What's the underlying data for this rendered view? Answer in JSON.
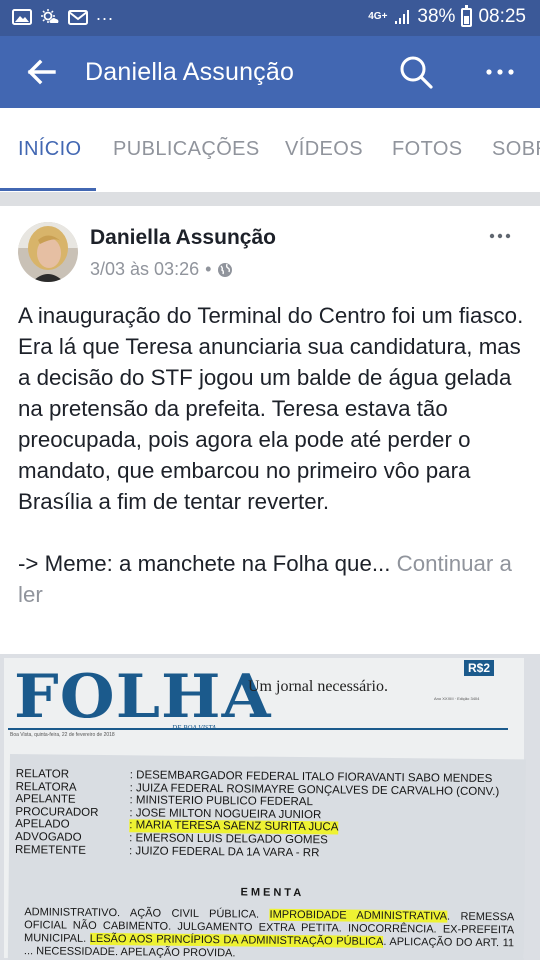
{
  "status_bar": {
    "overflow_dots": "...",
    "network": "4G+",
    "battery": "38%",
    "time": "08:25"
  },
  "app_bar": {
    "title": "Daniella Assunção"
  },
  "tabs": [
    {
      "label": "INÍCIO",
      "active": true
    },
    {
      "label": "PUBLICAÇÕES",
      "active": false
    },
    {
      "label": "VÍDEOS",
      "active": false
    },
    {
      "label": "FOTOS",
      "active": false
    },
    {
      "label": "SOBR",
      "active": false
    }
  ],
  "post": {
    "author": "Daniella Assunção",
    "timestamp": "3/03 às 03:26",
    "separator": "•",
    "privacy_icon": "globe-icon",
    "paragraph1": "A inauguração do Terminal do Centro foi um fiasco. Era lá que Teresa anunciaria sua candidatura, mas a decisão do STF jogou um balde de água gelada na pretensão da prefeita. Teresa estava tão preocupada, pois agora ela pode até perder o mandato, que embarcou no primeiro vôo para Brasília a fim de tentar reverter.",
    "paragraph2": "-> Meme: a manchete na Folha que...",
    "continue_label": "Continuar a ler"
  },
  "photo": {
    "masthead": "FOLHA",
    "masthead_sub": "DE BOA VISTA",
    "tagline": "Um jornal necessário.",
    "price": "R$2",
    "edition": "Ano XXXIII · Edição 3404",
    "dateline": "Boa Vista, quinta-feira, 22 de fevereiro de 2018",
    "doc_rows": [
      {
        "label": "RELATOR",
        "value": ": DESEMBARGADOR FEDERAL ITALO FIORAVANTI SABO MENDES"
      },
      {
        "label": "RELATORA",
        "value": ": JUIZA FEDERAL ROSIMAYRE GONÇALVES DE CARVALHO (CONV.)"
      },
      {
        "label": "APELANTE",
        "value": ": MINISTERIO PUBLICO FEDERAL"
      },
      {
        "label": "PROCURADOR",
        "value": ": JOSE MILTON NOGUEIRA JUNIOR"
      },
      {
        "label": "APELADO",
        "value": ": MARIA TERESA SAENZ SURITA JUCA"
      },
      {
        "label": "ADVOGADO",
        "value": ": EMERSON LUIS DELGADO GOMES"
      },
      {
        "label": "REMETENTE",
        "value": ": JUIZO FEDERAL DA 1A VARA - RR"
      }
    ],
    "ementa_title": "EMENTA",
    "ementa_text_1": "ADMINISTRATIVO. AÇÃO CIVIL PÚBLICA. ",
    "ementa_hl_1": "IMPROBIDADE ADMINISTRATIVA",
    "ementa_text_2": ". REMESSA OFICIAL NÃO CABIMENTO. JULGAMENTO EXTRA PETITA. INOCORRÊNCIA. EX-PREFEITA MUNICIPAL. ",
    "ementa_hl_2": "LESÃO AOS PRINCÍPIOS DA ADMINISTRAÇÃO PÚBLICA",
    "ementa_text_3": ". APLICAÇÃO DO ART. 11 ... NECESSIDADE. APELAÇÃO PROVIDA."
  }
}
